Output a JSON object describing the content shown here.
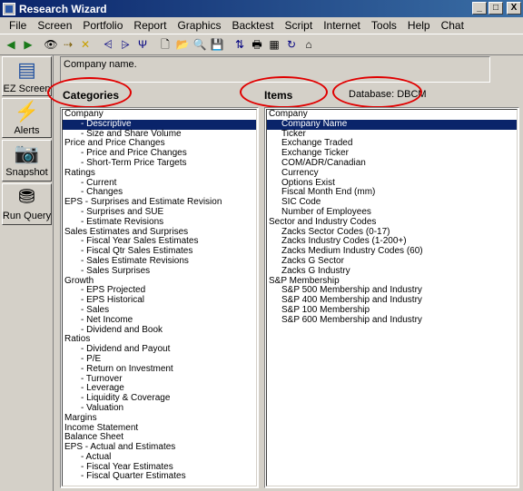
{
  "window": {
    "title": "Research Wizard",
    "minimize": "_",
    "maximize": "□",
    "close": "X"
  },
  "menu": [
    "File",
    "Screen",
    "Portfolio",
    "Report",
    "Graphics",
    "Backtest",
    "Script",
    "Internet",
    "Tools",
    "Help",
    "Chat"
  ],
  "toolbar": {
    "groups": [
      [
        {
          "name": "back-arrow-icon",
          "glyph": "◀",
          "color": "#1a7a1a"
        },
        {
          "name": "forward-arrow-icon",
          "glyph": "▶",
          "color": "#1a7a1a"
        }
      ],
      [
        {
          "name": "binoculars-icon",
          "glyph": "👁",
          "color": "#000000"
        },
        {
          "name": "find-next-icon",
          "glyph": "⇢",
          "color": "#7a5a00"
        },
        {
          "name": "delete-icon",
          "glyph": "✕",
          "color": "#c8a000"
        }
      ],
      [
        {
          "name": "filter-icon",
          "glyph": "⩤",
          "color": "#000080"
        },
        {
          "name": "sort-filter-icon",
          "glyph": "⩥",
          "color": "#000080"
        },
        {
          "name": "funnel-icon",
          "glyph": "Ψ",
          "color": "#000080"
        }
      ],
      [
        {
          "name": "new-document-icon",
          "glyph": "🗋",
          "color": "#000000"
        },
        {
          "name": "open-folder-icon",
          "glyph": "📂",
          "color": "#a07800"
        },
        {
          "name": "preview-icon",
          "glyph": "🔍",
          "color": "#000000"
        },
        {
          "name": "save-icon",
          "glyph": "💾",
          "color": "#000000"
        }
      ],
      [
        {
          "name": "sort-icon",
          "glyph": "⇅",
          "color": "#000080"
        },
        {
          "name": "print-icon",
          "glyph": "🖶",
          "color": "#000000"
        },
        {
          "name": "calculator-icon",
          "glyph": "▦",
          "color": "#000000"
        },
        {
          "name": "refresh-icon",
          "glyph": "↻",
          "color": "#000080"
        },
        {
          "name": "home-icon",
          "glyph": "⌂",
          "color": "#000000"
        }
      ]
    ]
  },
  "sidebar": [
    {
      "label": "EZ Screen",
      "icon": "ez-screen-icon",
      "glyph": "▤",
      "color": "#1f4f9f"
    },
    {
      "label": "Alerts",
      "icon": "lightning-icon",
      "glyph": "⚡",
      "color": "#e8c800"
    },
    {
      "label": "Snapshot",
      "icon": "camera-icon",
      "glyph": "📷",
      "color": "#000000"
    },
    {
      "label": "Run Query",
      "icon": "binoculars-icon",
      "glyph": "⛃",
      "color": "#000000"
    }
  ],
  "description": "Company name.",
  "headers": {
    "categories": "Categories",
    "items": "Items",
    "database": "Database: DBCM"
  },
  "categories": [
    {
      "text": "Company",
      "indent": false,
      "selected": false
    },
    {
      "text": "- Descriptive",
      "indent": true,
      "selected": true
    },
    {
      "text": "- Size and Share Volume",
      "indent": true,
      "selected": false
    },
    {
      "text": "Price and Price Changes",
      "indent": false,
      "selected": false
    },
    {
      "text": "- Price and Price Changes",
      "indent": true,
      "selected": false
    },
    {
      "text": "- Short-Term Price Targets",
      "indent": true,
      "selected": false
    },
    {
      "text": "Ratings",
      "indent": false,
      "selected": false
    },
    {
      "text": "- Current",
      "indent": true,
      "selected": false
    },
    {
      "text": "- Changes",
      "indent": true,
      "selected": false
    },
    {
      "text": "EPS - Surprises and Estimate Revision",
      "indent": false,
      "selected": false
    },
    {
      "text": "- Surprises and SUE",
      "indent": true,
      "selected": false
    },
    {
      "text": "- Estimate Revisions",
      "indent": true,
      "selected": false
    },
    {
      "text": "Sales Estimates and Surprises",
      "indent": false,
      "selected": false
    },
    {
      "text": "- Fiscal Year Sales Estimates",
      "indent": true,
      "selected": false
    },
    {
      "text": "- Fiscal Qtr Sales Estimates",
      "indent": true,
      "selected": false
    },
    {
      "text": "- Sales Estimate Revisions",
      "indent": true,
      "selected": false
    },
    {
      "text": "- Sales Surprises",
      "indent": true,
      "selected": false
    },
    {
      "text": "Growth",
      "indent": false,
      "selected": false
    },
    {
      "text": "- EPS Projected",
      "indent": true,
      "selected": false
    },
    {
      "text": "- EPS Historical",
      "indent": true,
      "selected": false
    },
    {
      "text": "- Sales",
      "indent": true,
      "selected": false
    },
    {
      "text": "- Net Income",
      "indent": true,
      "selected": false
    },
    {
      "text": "- Dividend and Book",
      "indent": true,
      "selected": false
    },
    {
      "text": "Ratios",
      "indent": false,
      "selected": false
    },
    {
      "text": "- Dividend and Payout",
      "indent": true,
      "selected": false
    },
    {
      "text": "- P/E",
      "indent": true,
      "selected": false
    },
    {
      "text": "- Return on Investment",
      "indent": true,
      "selected": false
    },
    {
      "text": "- Turnover",
      "indent": true,
      "selected": false
    },
    {
      "text": "- Leverage",
      "indent": true,
      "selected": false
    },
    {
      "text": "- Liquidity & Coverage",
      "indent": true,
      "selected": false
    },
    {
      "text": "- Valuation",
      "indent": true,
      "selected": false
    },
    {
      "text": "Margins",
      "indent": false,
      "selected": false
    },
    {
      "text": "Income Statement",
      "indent": false,
      "selected": false
    },
    {
      "text": "Balance Sheet",
      "indent": false,
      "selected": false
    },
    {
      "text": "EPS - Actual and Estimates",
      "indent": false,
      "selected": false
    },
    {
      "text": "- Actual",
      "indent": true,
      "selected": false
    },
    {
      "text": "- Fiscal Year Estimates",
      "indent": true,
      "selected": false
    },
    {
      "text": "- Fiscal Quarter Estimates",
      "indent": true,
      "selected": false
    }
  ],
  "items": [
    {
      "text": "Company",
      "indent": false,
      "selected": false
    },
    {
      "text": "Company Name",
      "indent": true,
      "selected": true
    },
    {
      "text": "Ticker",
      "indent": true,
      "selected": false
    },
    {
      "text": "Exchange Traded",
      "indent": true,
      "selected": false
    },
    {
      "text": "Exchange Ticker",
      "indent": true,
      "selected": false
    },
    {
      "text": "COM/ADR/Canadian",
      "indent": true,
      "selected": false
    },
    {
      "text": "Currency",
      "indent": true,
      "selected": false
    },
    {
      "text": "Options Exist",
      "indent": true,
      "selected": false
    },
    {
      "text": "Fiscal Month End (mm)",
      "indent": true,
      "selected": false
    },
    {
      "text": "SIC Code",
      "indent": true,
      "selected": false
    },
    {
      "text": "Number of Employees",
      "indent": true,
      "selected": false
    },
    {
      "text": "Sector and Industry Codes",
      "indent": false,
      "selected": false
    },
    {
      "text": "Zacks Sector Codes (0-17)",
      "indent": true,
      "selected": false
    },
    {
      "text": "Zacks Industry Codes (1-200+)",
      "indent": true,
      "selected": false
    },
    {
      "text": "Zacks Medium Industry Codes (60)",
      "indent": true,
      "selected": false
    },
    {
      "text": "Zacks G Sector",
      "indent": true,
      "selected": false
    },
    {
      "text": "Zacks G Industry",
      "indent": true,
      "selected": false
    },
    {
      "text": "S&P Membership",
      "indent": false,
      "selected": false
    },
    {
      "text": "S&P 500 Membership and Industry",
      "indent": true,
      "selected": false
    },
    {
      "text": "S&P 400 Membership and Industry",
      "indent": true,
      "selected": false
    },
    {
      "text": "S&P 100 Membership",
      "indent": true,
      "selected": false
    },
    {
      "text": "S&P 600 Membership and Industry",
      "indent": true,
      "selected": false
    }
  ],
  "colors": {
    "annotation": "#e00000",
    "selection": "#0a246a",
    "title_bar": "#0a246a"
  }
}
